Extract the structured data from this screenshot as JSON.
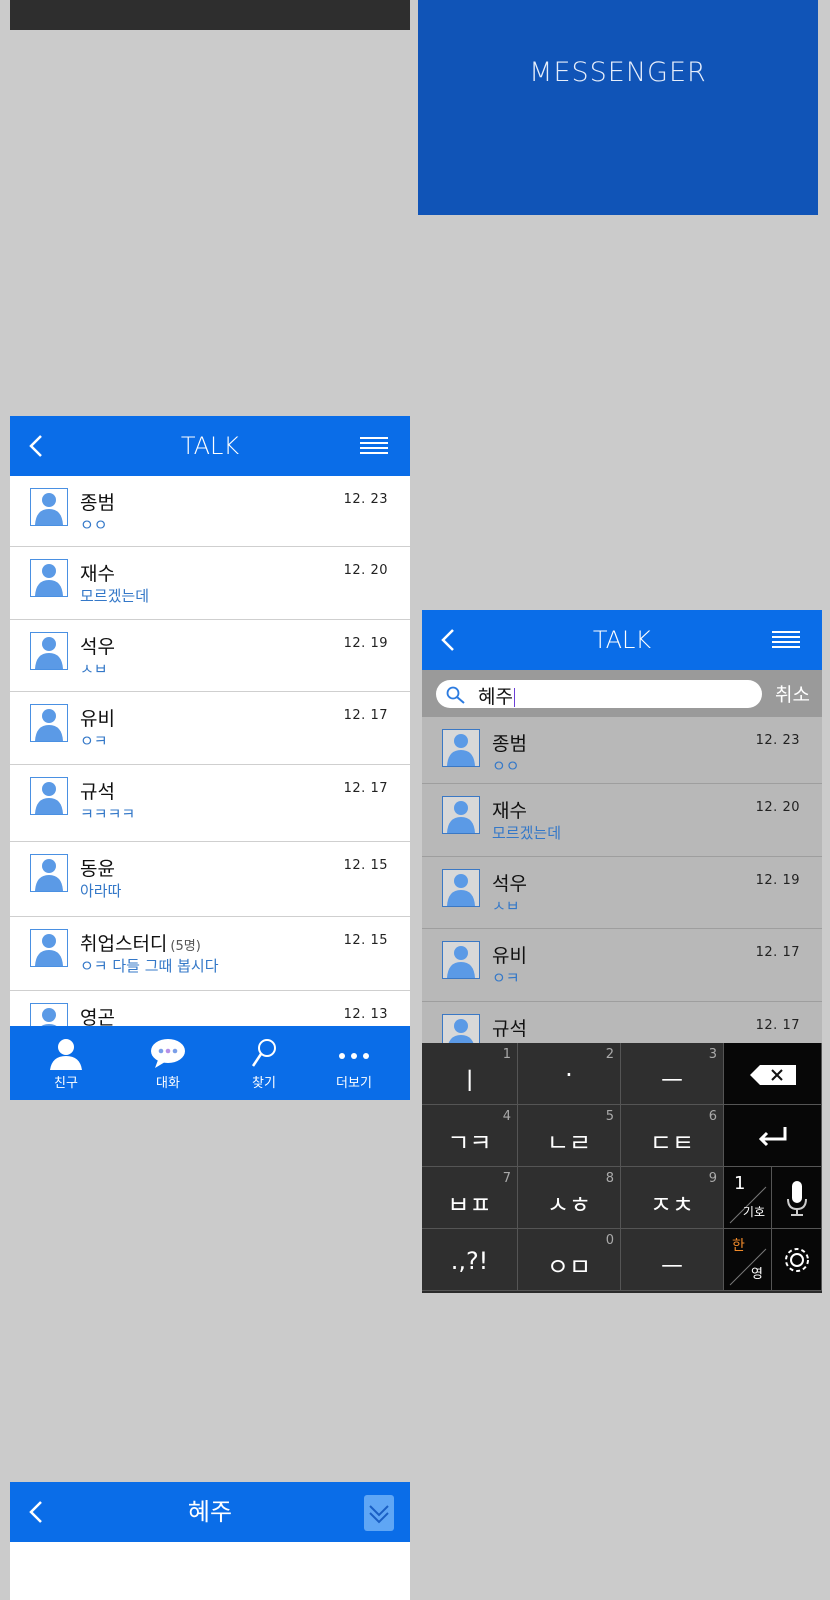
{
  "splash": {
    "title": "MESSENGER"
  },
  "talk": {
    "title": "TALK",
    "rows": [
      {
        "name": "종범",
        "msg": "ㅇㅇ",
        "date": "12. 23"
      },
      {
        "name": "재수",
        "msg": "모르겠는데",
        "date": "12. 20"
      },
      {
        "name": "석우",
        "msg": "ㅅㅂ",
        "date": "12. 19"
      },
      {
        "name": "유비",
        "msg": "ㅇㅋ",
        "date": "12. 17"
      },
      {
        "name": "규석",
        "msg": "ㅋㅋㅋㅋ",
        "date": "12. 17"
      },
      {
        "name": "동윤",
        "msg": "아라따",
        "date": "12. 15"
      },
      {
        "name": "취업스터디",
        "count": "(5명)",
        "msg": "ㅇㅋ 다들 그때 봅시다",
        "date": "12. 15"
      },
      {
        "name": "영곤",
        "msg": "",
        "date": "12. 13"
      }
    ],
    "nav": [
      {
        "label": "친구"
      },
      {
        "label": "대화"
      },
      {
        "label": "찾기"
      },
      {
        "label": "더보기"
      }
    ]
  },
  "search": {
    "title": "TALK",
    "query": "혜주",
    "cancel": "취소",
    "rows": [
      {
        "name": "종범",
        "msg": "ㅇㅇ",
        "date": "12. 23"
      },
      {
        "name": "재수",
        "msg": "모르겠는데",
        "date": "12. 20"
      },
      {
        "name": "석우",
        "msg": "ㅅㅂ",
        "date": "12. 19"
      },
      {
        "name": "유비",
        "msg": "ㅇㅋ",
        "date": "12. 17"
      },
      {
        "name": "규석",
        "msg": "",
        "date": "12. 17"
      }
    ],
    "keys": [
      {
        "g": "ㅣ",
        "n": "1"
      },
      {
        "g": "·",
        "n": "2"
      },
      {
        "g": "ㅡ",
        "n": "3"
      },
      {
        "g": "ㄱㅋ",
        "n": "4"
      },
      {
        "g": "ㄴㄹ",
        "n": "5"
      },
      {
        "g": "ㄷㅌ",
        "n": "6"
      },
      {
        "g": "ㅂㅍ",
        "n": "7"
      },
      {
        "g": "ㅅㅎ",
        "n": "8"
      },
      {
        "g": "ㅈㅊ",
        "n": "9"
      },
      {
        "g": ".,?!",
        "n": ""
      },
      {
        "g": "ㅇㅁ",
        "n": "0"
      },
      {
        "g": "ㅡ",
        "n": ""
      }
    ],
    "symbol_top": "1",
    "symbol_bottom": "기호",
    "lang_top": "한",
    "lang_bottom": "영"
  },
  "chat": {
    "title": "혜주"
  }
}
